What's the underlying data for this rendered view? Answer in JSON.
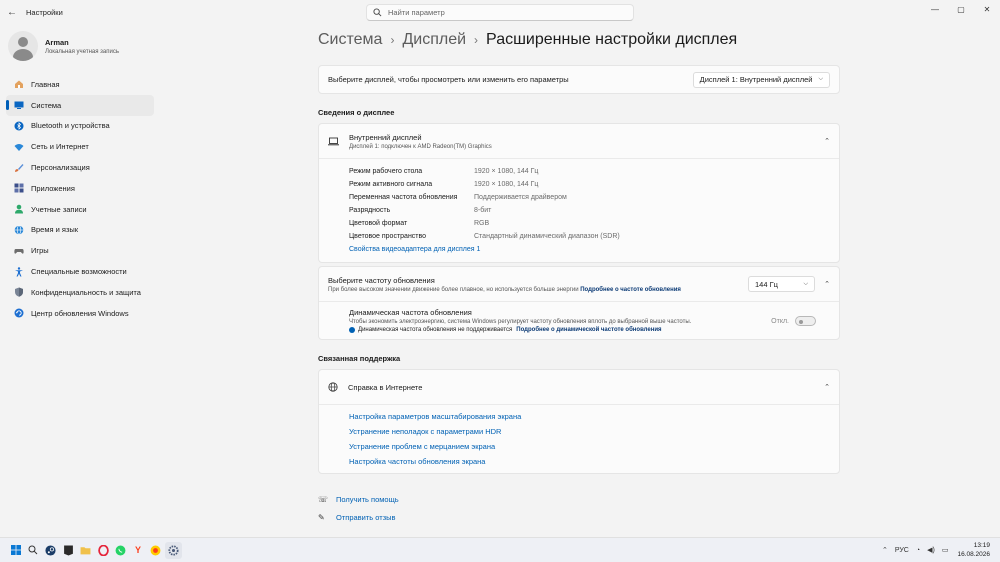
{
  "window": {
    "title": "Настройки",
    "search_placeholder": "Найти параметр",
    "controls": [
      "—",
      "▢",
      "✕"
    ]
  },
  "user": {
    "name": "Arman",
    "account_type": "Локальная учетная запись"
  },
  "sidebar": {
    "items": [
      {
        "label": "Главная",
        "icon": "home-icon",
        "color": "#d8843c"
      },
      {
        "label": "Система",
        "icon": "monitor-icon",
        "color": "#0a66c2",
        "active": true
      },
      {
        "label": "Bluetooth и устройства",
        "icon": "bluetooth-icon",
        "color": "#0a66c2"
      },
      {
        "label": "Сеть и Интернет",
        "icon": "wifi-icon",
        "color": "#2a88d8"
      },
      {
        "label": "Персонализация",
        "icon": "brush-icon",
        "color": "#d86f3c"
      },
      {
        "label": "Приложения",
        "icon": "apps-icon",
        "color": "#3c4f8a"
      },
      {
        "label": "Учетные записи",
        "icon": "person-icon",
        "color": "#2ea96b"
      },
      {
        "label": "Время и язык",
        "icon": "globe-icon",
        "color": "#2a88d8"
      },
      {
        "label": "Игры",
        "icon": "gamepad-icon",
        "color": "#6d6d6d"
      },
      {
        "label": "Специальные возможности",
        "icon": "accessibility-icon",
        "color": "#1d6fd1"
      },
      {
        "label": "Конфиденциальность и защита",
        "icon": "shield-icon",
        "color": "#7a8596"
      },
      {
        "label": "Центр обновления Windows",
        "icon": "update-icon",
        "color": "#1d6fd1"
      }
    ]
  },
  "breadcrumb": {
    "items": [
      "Система",
      "Дисплей"
    ],
    "current": "Расширенные настройки дисплея",
    "separator": "›"
  },
  "display_selector": {
    "label": "Выберите дисплей, чтобы просмотреть или изменить его параметры",
    "value": "Дисплей 1: Внутренний дисплей"
  },
  "display_info": {
    "section_title": "Сведения о дисплее",
    "title": "Внутренний дисплей",
    "subtitle": "Дисплей 1: подключен к AMD Radeon(TM) Graphics",
    "properties": [
      {
        "key": "Режим рабочего стола",
        "value": "1920 × 1080, 144 Гц"
      },
      {
        "key": "Режим активного сигнала",
        "value": "1920 × 1080, 144 Гц"
      },
      {
        "key": "Переменная частота обновления",
        "value": "Поддерживается драйвером"
      },
      {
        "key": "Разрядность",
        "value": "8-бит"
      },
      {
        "key": "Цветовой формат",
        "value": "RGB"
      },
      {
        "key": "Цветовое пространство",
        "value": "Стандартный динамический диапазон (SDR)"
      }
    ],
    "adapter_link": "Свойства видеоадаптера для дисплея 1"
  },
  "refresh_rate": {
    "title": "Выберите частоту обновления",
    "subtitle": "При более высоком значении движение более плавное, но используется больше энергии",
    "more_link": "Подробнее о частоте обновления",
    "value": "144 Гц",
    "dynamic": {
      "title": "Динамическая частота обновления",
      "subtitle": "Чтобы экономить электроэнергию, система Windows регулирует частоту обновления вплоть до выбранной выше частоты.",
      "info": "Динамическая частота обновления не поддерживается",
      "info_link": "Подробнее о динамической частоте обновления",
      "toggle_label": "Откл."
    }
  },
  "related_support": {
    "section_title": "Связанная поддержка",
    "title": "Справка в Интернете",
    "links": [
      "Настройка параметров масштабирования экрана",
      "Устранение неполадок с параметрами HDR",
      "Устранение проблем с мерцанием экрана",
      "Настройка частоты обновления экрана"
    ]
  },
  "bottom_links": {
    "help": "Получить помощь",
    "feedback": "Отправить отзыв"
  },
  "taskbar": {
    "icons": [
      "start-icon",
      "search-icon",
      "steam-icon",
      "epic-games-icon",
      "file-explorer-icon",
      "opera-gx-icon",
      "whatsapp-icon",
      "yandex-icon",
      "yandex-browser-icon",
      "settings-icon"
    ],
    "language": "РУС",
    "time": "13:19",
    "date": "16.08.2026"
  }
}
